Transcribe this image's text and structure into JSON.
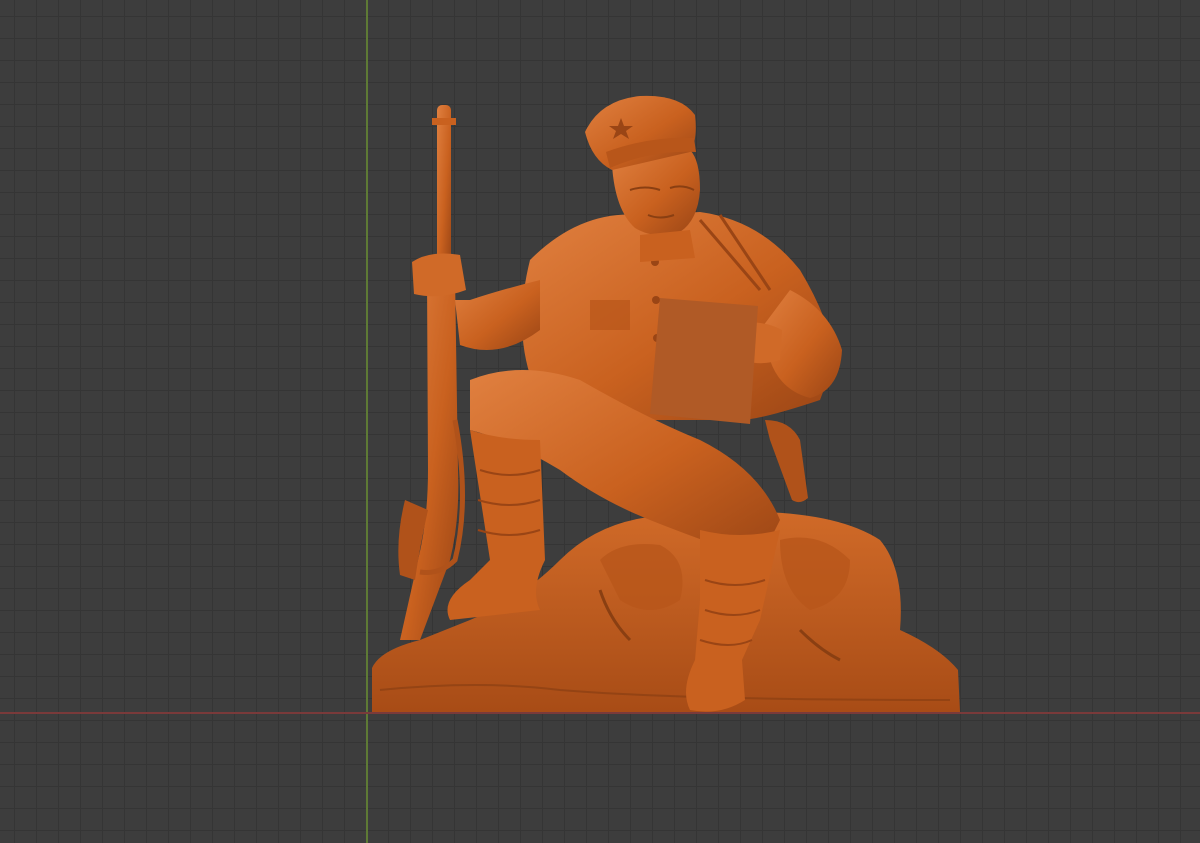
{
  "viewport": {
    "background_color": "#3d3d3d",
    "grid_color": "#353535",
    "axis_x_color": "#7a3a3a",
    "axis_y_color": "#5e7a35"
  },
  "model": {
    "material_color": "#c9611f",
    "shadow_color": "#8a3f12",
    "highlight_color": "#e08040"
  }
}
